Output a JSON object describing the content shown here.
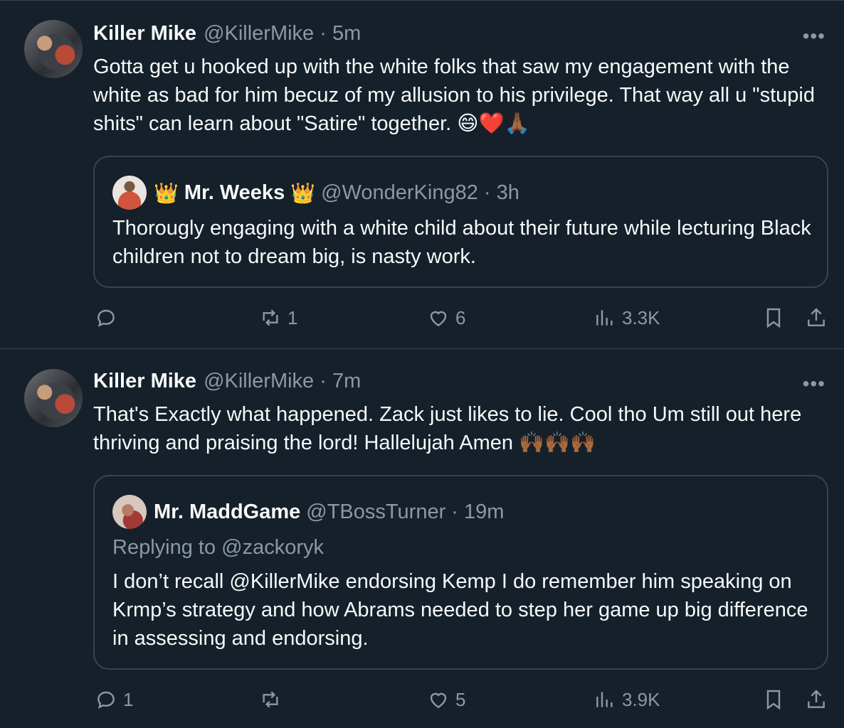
{
  "tweets": [
    {
      "author_name": "Killer Mike",
      "handle_time": "@KillerMike · 5m",
      "text": "Gotta get u hooked up with the white folks that saw my engagement with the white as bad for him becuz of my allusion to his privilege.  That way all u \"stupid shits\" can learn about \"Satire\" together.  😄❤️🙏🏾",
      "quote": {
        "crown": "👑",
        "author_name": "Mr. Weeks",
        "handle_time": "@WonderKing82 · 3h",
        "replying_to": "",
        "text": "Thorougly engaging with a white child about their future while lecturing Black children not to dream big, is nasty work."
      },
      "stats": {
        "replies": "",
        "reposts": "1",
        "likes": "6",
        "views": "3.3K"
      }
    },
    {
      "author_name": "Killer Mike",
      "handle_time": "@KillerMike · 7m",
      "text": "That's Exactly what happened.  Zack just likes to lie.  Cool tho Um still out here thriving and praising the lord! Hallelujah Amen 🙌🏾🙌🏾🙌🏾",
      "quote": {
        "author_name": "Mr. MaddGame",
        "handle_time": "@TBossTurner · 19m",
        "replying_to": "Replying to @zackoryk",
        "text": "I don’t recall @KillerMike endorsing Kemp I do remember him speaking on Krmp’s strategy and how Abrams needed to step her game up big difference in assessing and endorsing."
      },
      "stats": {
        "replies": "1",
        "reposts": "",
        "likes": "5",
        "views": "3.9K"
      }
    }
  ],
  "more_label": "•••",
  "icons": [
    "reply-icon",
    "repost-icon",
    "like-icon",
    "views-icon",
    "bookmark-icon",
    "share-icon",
    "more-icon",
    "crown-icon"
  ],
  "colors": {
    "background": "#15202b",
    "text": "#f7f9f9",
    "secondary": "#8b98a5",
    "border": "#38444d"
  }
}
